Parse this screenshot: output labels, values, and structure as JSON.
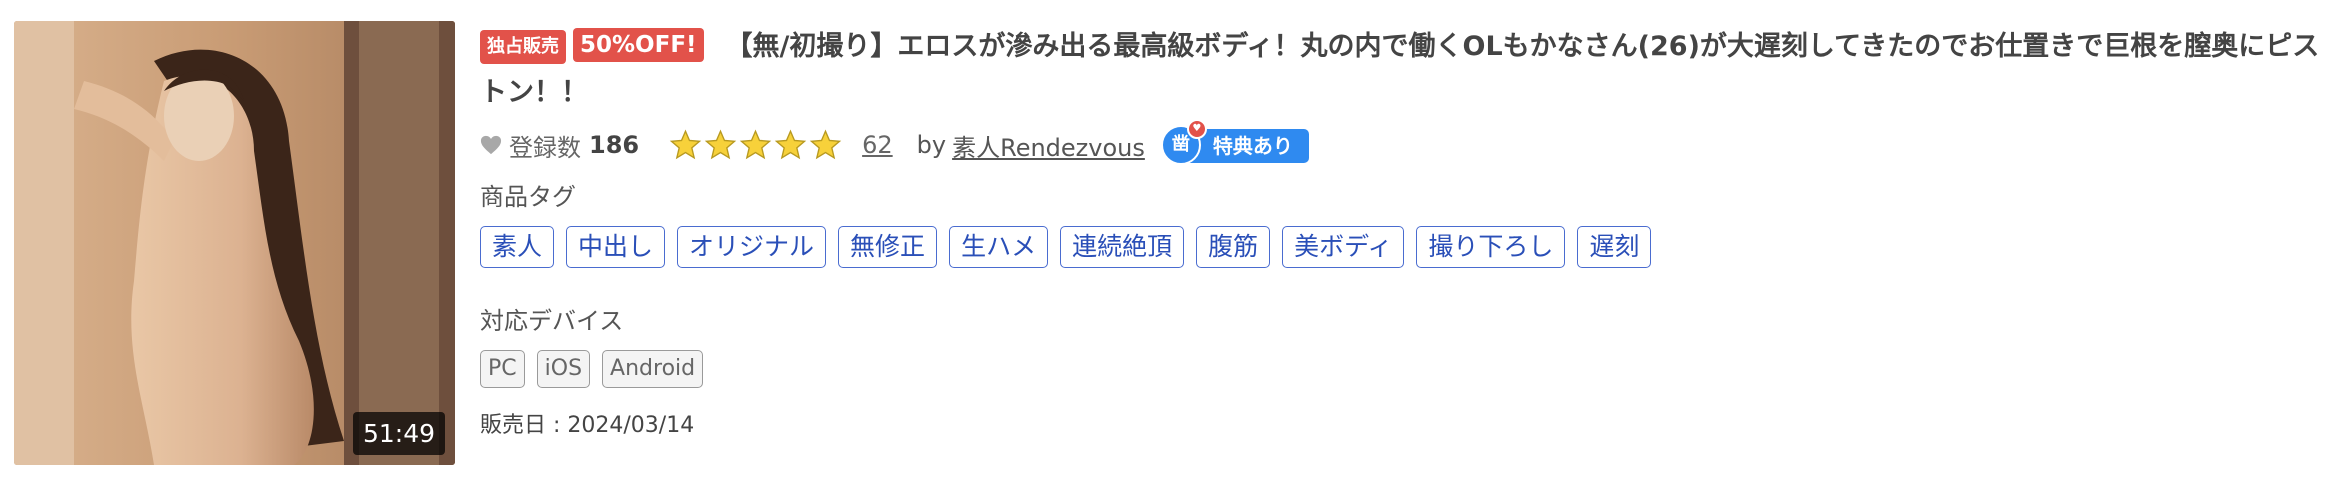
{
  "thumbnail": {
    "duration": "51:49"
  },
  "badges": {
    "exclusive": "独占販売",
    "sale": "50%OFF!"
  },
  "title": "【無/初撮り】エロスが滲み出る最高級ボディ！丸の内で働くOLもかなさん(26)が大遅刻してきたのでお仕置きで巨根を膣奥にピストン！！",
  "favorites": {
    "label": "登録数",
    "count": "186"
  },
  "rating": {
    "stars_filled": 5,
    "stars_total": 5,
    "review_count": "62"
  },
  "maker": {
    "prefix": "by",
    "name": "素人Rendezvous"
  },
  "tokuten": {
    "circle_label": "凿",
    "label": "特典あり"
  },
  "tags": {
    "label": "商品タグ",
    "items": [
      "素人",
      "中出し",
      "オリジナル",
      "無修正",
      "生ハメ",
      "連続絶頂",
      "腹筋",
      "美ボディ",
      "撮り下ろし",
      "遅刻"
    ]
  },
  "devices": {
    "label": "対応デバイス",
    "items": [
      "PC",
      "iOS",
      "Android"
    ]
  },
  "release": "販売日 : 2024/03/14",
  "colors": {
    "badge_red": "#e2524a",
    "star_yellow": "#f7d13a",
    "tag_blue": "#2a4fb8",
    "tokuten_blue": "#2f8af0"
  }
}
